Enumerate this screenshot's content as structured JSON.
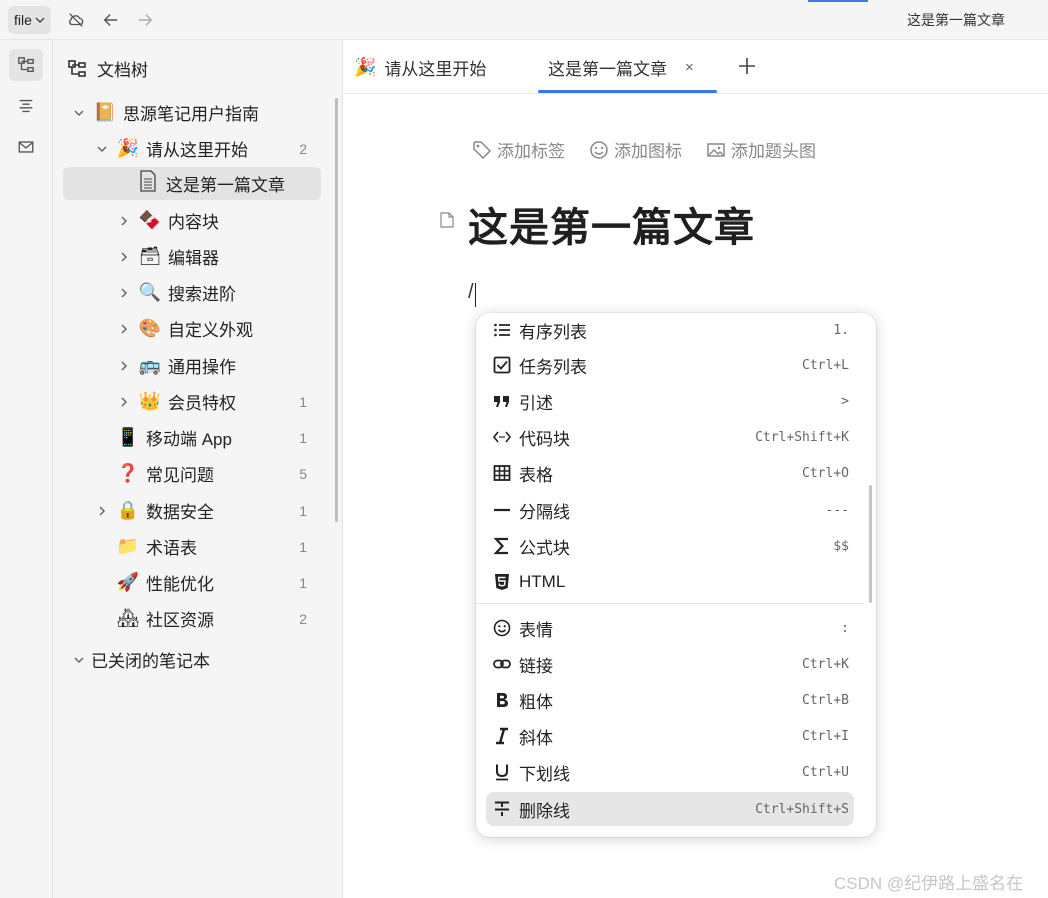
{
  "topbar": {
    "file_label": "file",
    "window_title": "这是第一篇文章",
    "icons": [
      "cloud-off-icon",
      "arrow-left-icon",
      "arrow-right-icon"
    ]
  },
  "dock": {
    "items": [
      "file-tree-icon",
      "outline-icon",
      "inbox-icon"
    ]
  },
  "filetree": {
    "header": "文档树",
    "items": [
      {
        "label": "思源笔记用户指南",
        "emoji": "📔",
        "count": ""
      },
      {
        "label": "请从这里开始",
        "emoji": "🎉",
        "count": "2"
      },
      {
        "label": "这是第一篇文章",
        "emoji": "🗎",
        "count": ""
      },
      {
        "label": "内容块",
        "emoji": "🍫",
        "count": ""
      },
      {
        "label": "编辑器",
        "emoji": "🗃",
        "count": ""
      },
      {
        "label": "搜索进阶",
        "emoji": "🔍",
        "count": ""
      },
      {
        "label": "自定义外观",
        "emoji": "🎨",
        "count": ""
      },
      {
        "label": "通用操作",
        "emoji": "🚌",
        "count": ""
      },
      {
        "label": "会员特权",
        "emoji": "👑",
        "count": "1"
      },
      {
        "label": "移动端 App",
        "emoji": "📱",
        "count": "1"
      },
      {
        "label": "常见问题",
        "emoji": "❓",
        "count": "5"
      },
      {
        "label": "数据安全",
        "emoji": "🔒",
        "count": "1"
      },
      {
        "label": "术语表",
        "emoji": "📁",
        "count": "1"
      },
      {
        "label": "性能优化",
        "emoji": "🚀",
        "count": "1"
      },
      {
        "label": "社区资源",
        "emoji": "🏘",
        "count": "2"
      }
    ],
    "closed_notebooks": "已关闭的笔记本"
  },
  "tabs": [
    {
      "label": "请从这里开始",
      "emoji": "🎉"
    },
    {
      "label": "这是第一篇文章",
      "close": "×"
    }
  ],
  "editor": {
    "actions": [
      "添加标签",
      "添加图标",
      "添加题头图"
    ],
    "title": "这是第一篇文章",
    "input": "/"
  },
  "slash_menu": {
    "items": [
      {
        "label": "有序列表",
        "shortcut": "1.",
        "icon": "ordered-list-icon"
      },
      {
        "label": "任务列表",
        "shortcut": "Ctrl+L",
        "icon": "checkbox-icon"
      },
      {
        "label": "引述",
        "shortcut": ">",
        "icon": "quote-icon"
      },
      {
        "label": "代码块",
        "shortcut": "Ctrl+Shift+K",
        "icon": "code-icon"
      },
      {
        "label": "表格",
        "shortcut": "Ctrl+O",
        "icon": "table-icon"
      },
      {
        "label": "分隔线",
        "shortcut": "---",
        "icon": "divider-icon"
      },
      {
        "label": "公式块",
        "shortcut": "$$",
        "icon": "sigma-icon"
      },
      {
        "label": "HTML",
        "shortcut": "",
        "icon": "html5-icon"
      },
      {
        "label": "表情",
        "shortcut": ":",
        "icon": "smiley-icon"
      },
      {
        "label": "链接",
        "shortcut": "Ctrl+K",
        "icon": "link-icon"
      },
      {
        "label": "粗体",
        "shortcut": "Ctrl+B",
        "icon": "bold-icon"
      },
      {
        "label": "斜体",
        "shortcut": "Ctrl+I",
        "icon": "italic-icon"
      },
      {
        "label": "下划线",
        "shortcut": "Ctrl+U",
        "icon": "underline-icon"
      },
      {
        "label": "删除线",
        "shortcut": "Ctrl+Shift+S",
        "icon": "strikethrough-icon"
      }
    ]
  },
  "watermark": "CSDN @纪伊路上盛名在",
  "colors": {
    "accent": "#3b78e7",
    "sidebar_bg": "#f5f5f5",
    "selected_bg": "#e3e3e3"
  }
}
